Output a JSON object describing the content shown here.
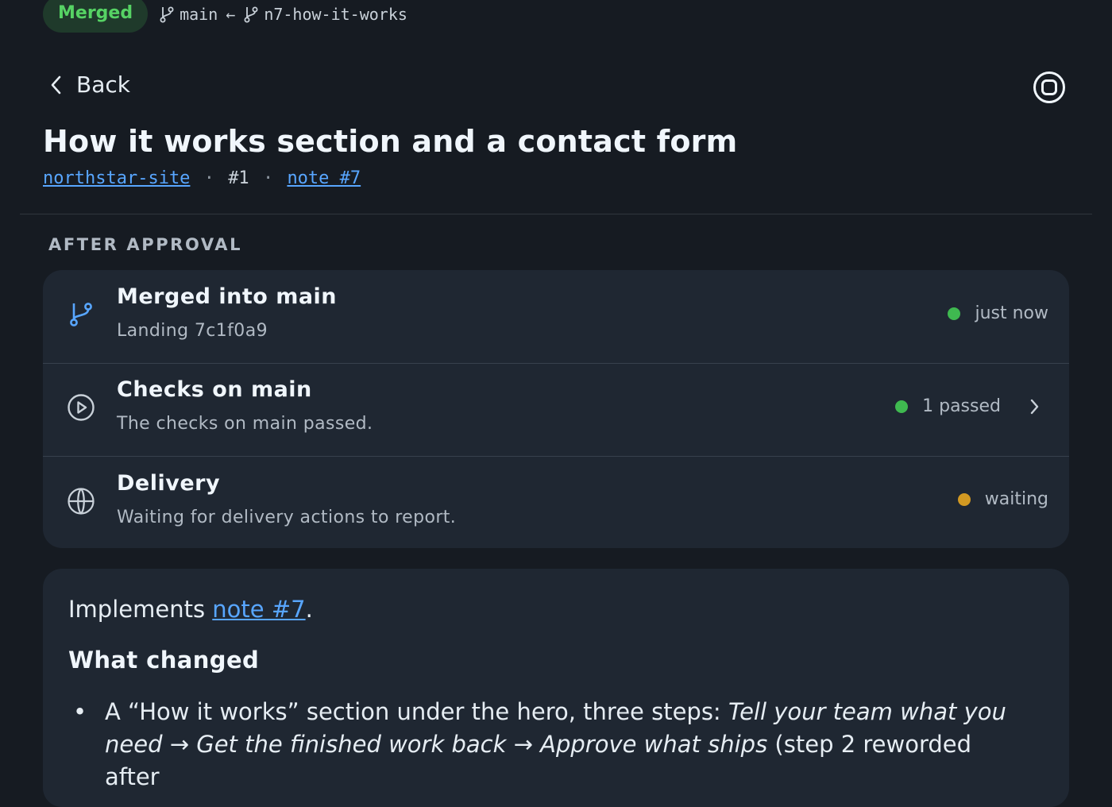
{
  "header": {
    "status_badge": "Merged",
    "base_branch": "main",
    "arrow": "←",
    "head_branch": "n7-how-it-works"
  },
  "nav": {
    "back_label": "Back"
  },
  "pr": {
    "title": "How it works section and a contact form",
    "repo": "northstar-site",
    "number": "#1",
    "note_link": "note #7",
    "separator": "·"
  },
  "after_approval": {
    "label": "AFTER APPROVAL",
    "rows": [
      {
        "icon": "merge-branch-icon",
        "title": "Merged into main",
        "subtitle": "Landing 7c1f0a9",
        "status": "just now",
        "status_color": "#3fb950"
      },
      {
        "icon": "play-circle-icon",
        "title": "Checks on main",
        "subtitle": "The checks on main passed.",
        "status": "1 passed",
        "status_color": "#3fb950"
      },
      {
        "icon": "globe-icon",
        "title": "Delivery",
        "subtitle": "Waiting for delivery actions to report.",
        "status": "waiting",
        "status_color": "#d29922"
      }
    ]
  },
  "description": {
    "intro_prefix": "Implements ",
    "intro_link": "note #7",
    "intro_suffix": ".",
    "heading": "What changed",
    "bullet_1_a": "A “How it works” section under the hero, three steps: ",
    "bullet_1_b": "Tell your team what you need",
    "bullet_1_arrow_1": " → ",
    "bullet_1_c": "Get the finished work back",
    "bullet_1_arrow_2": " → ",
    "bullet_1_d": "Approve what ships",
    "bullet_1_e": " (step 2 reworded after"
  },
  "colors": {
    "accent_link": "#58a6ff",
    "merged_green": "#56d364",
    "background": "#161b22",
    "card": "#1f2732"
  }
}
